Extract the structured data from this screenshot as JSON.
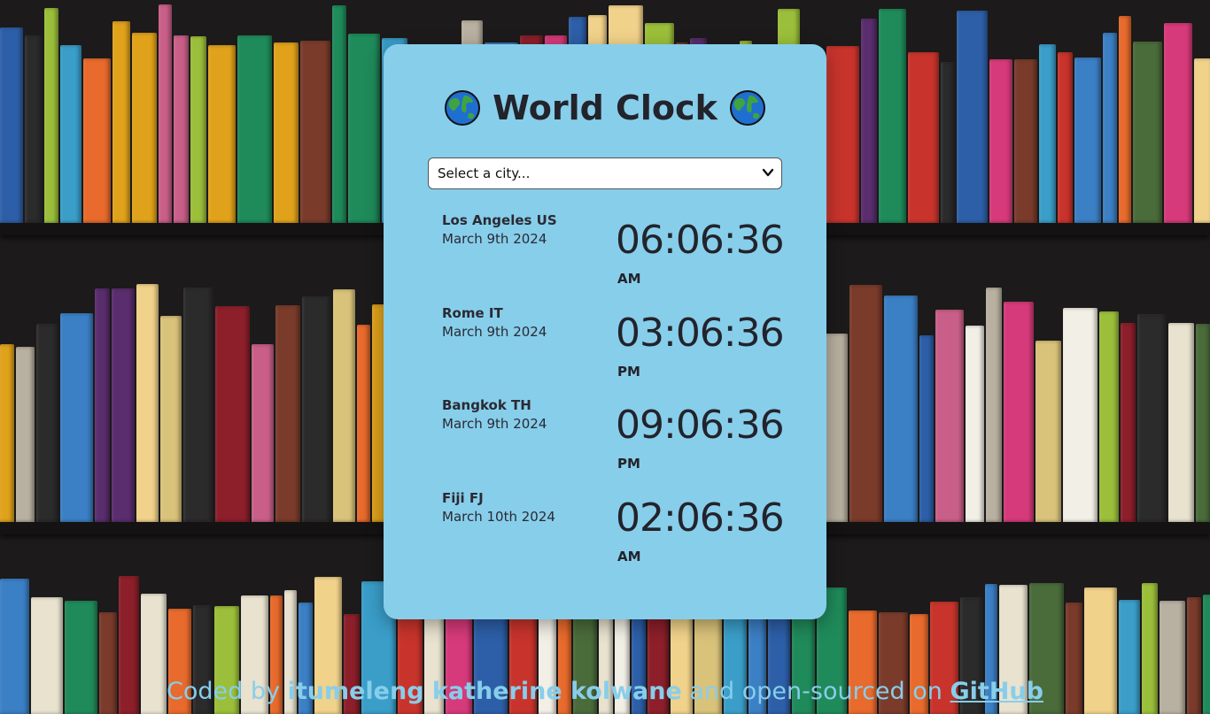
{
  "header": {
    "title": "World Clock",
    "icon_left": "globe-icon",
    "icon_right": "globe-icon"
  },
  "city_select": {
    "selected": "Select a city...",
    "icon": "chevron-down-icon"
  },
  "cities": [
    {
      "name": "Los Angeles US",
      "date": "March 9th 2024",
      "time": "06:06:36",
      "period": "AM"
    },
    {
      "name": "Rome IT",
      "date": "March 9th 2024",
      "time": "03:06:36",
      "period": "PM"
    },
    {
      "name": "Bangkok TH",
      "date": "March 9th 2024",
      "time": "09:06:36",
      "period": "PM"
    },
    {
      "name": "Fiji FJ",
      "date": "March 10th 2024",
      "time": "02:06:36",
      "period": "AM"
    }
  ],
  "footer": {
    "prefix": "Coded by",
    "author": "itumeleng katherine kolwane",
    "middle": "and open-sourced on",
    "link": "GitHub"
  },
  "colors": {
    "card": "#87ceeb",
    "text": "#23232b",
    "footer": "#87ceeb",
    "background": "#1c1a1a"
  }
}
